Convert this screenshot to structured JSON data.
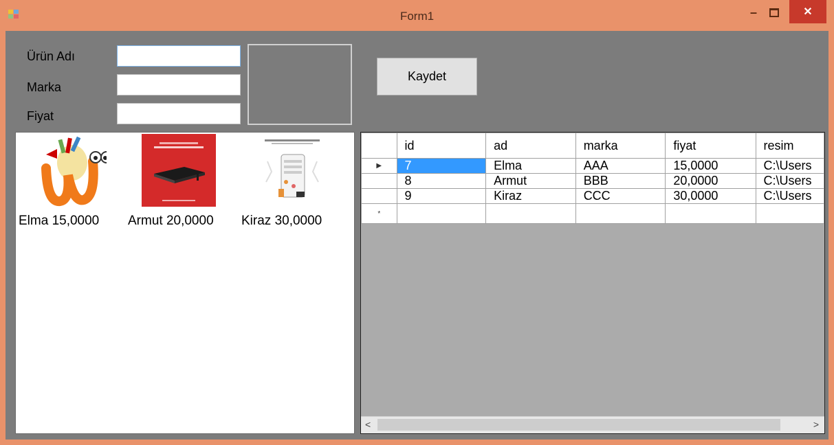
{
  "window": {
    "title": "Form1"
  },
  "form": {
    "labels": {
      "urun_adi": "Ürün Adı",
      "marka": "Marka",
      "fiyat": "Fiyat"
    },
    "values": {
      "urun_adi": "",
      "marka": "",
      "fiyat": ""
    },
    "save_button": "Kaydet"
  },
  "products": [
    {
      "caption": "Elma 15,0000",
      "icon": "bookworm-image"
    },
    {
      "caption": "Armut 20,0000",
      "icon": "red-book-cover-image"
    },
    {
      "caption": "Kiraz 30,0000",
      "icon": "app-infographic-image"
    }
  ],
  "grid": {
    "columns": [
      "id",
      "ad",
      "marka",
      "fiyat",
      "resim"
    ],
    "rows": [
      [
        "7",
        "Elma",
        "AAA",
        "15,0000",
        "C:\\Users"
      ],
      [
        "8",
        "Armut",
        "BBB",
        "20,0000",
        "C:\\Users"
      ],
      [
        "9",
        "Kiraz",
        "CCC",
        "30,0000",
        "C:\\Users"
      ]
    ],
    "current_row_marker": "▶",
    "new_row_marker": "*"
  },
  "colors": {
    "title_bar": "#e9926a",
    "client": "#7c7c7c",
    "grid_background": "#ababab",
    "selection": "#3399ff",
    "close_button": "#c7392b"
  }
}
